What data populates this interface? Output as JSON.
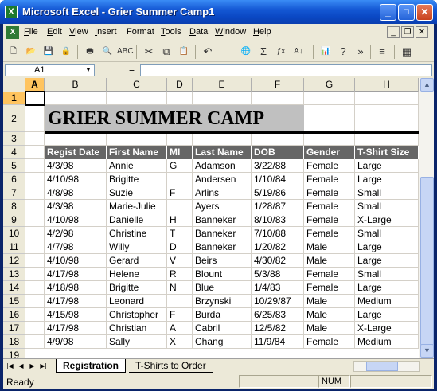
{
  "window": {
    "title": "Microsoft Excel - Grier Summer Camp1",
    "app_icon": "X",
    "minimize": "_",
    "maximize": "□",
    "close": "✕"
  },
  "menu": {
    "items": [
      {
        "key": "F",
        "rest": "ile"
      },
      {
        "key": "E",
        "rest": "dit"
      },
      {
        "key": "V",
        "rest": "iew"
      },
      {
        "key": "I",
        "rest": "nsert"
      },
      {
        "key": "",
        "rest": "Format"
      },
      {
        "key": "T",
        "rest": "ools"
      },
      {
        "key": "D",
        "rest": "ata"
      },
      {
        "key": "W",
        "rest": "indow"
      },
      {
        "key": "H",
        "rest": "elp"
      }
    ],
    "mdi_min": "_",
    "mdi_restore": "❐",
    "mdi_close": "✕"
  },
  "toolbar": {
    "icons": [
      "new-icon",
      "open-icon",
      "save-icon",
      "permission-icon",
      "print-icon",
      "print-preview-icon",
      "spelling-icon",
      "cut-icon",
      "copy-icon",
      "paste-icon",
      "undo-icon",
      "hyperlink-icon",
      "autosum-icon",
      "function-icon",
      "sort-ascending-icon",
      "chart-wizard-icon",
      "help-icon",
      "more-options-icon",
      "align-icon",
      "borders-icon"
    ],
    "glyphs": [
      "🗋",
      "📂",
      "💾",
      "🔒",
      "🖶",
      "🔍",
      "ABC",
      "✂",
      "⧉",
      "📋",
      "↶",
      "🌐",
      "Σ",
      "ƒx",
      "A↓",
      "📊",
      "?",
      "»",
      "≡",
      "▦"
    ]
  },
  "formula_bar": {
    "name_box": "A1",
    "equals": "=",
    "value": ""
  },
  "sheet": {
    "columns": [
      "A",
      "B",
      "C",
      "D",
      "E",
      "F",
      "G",
      "H"
    ],
    "selected_column": "A",
    "rows": [
      "1",
      "2",
      "3",
      "4",
      "5",
      "6",
      "7",
      "8",
      "9",
      "10",
      "11",
      "12",
      "13",
      "14",
      "15",
      "16",
      "17",
      "18",
      "19"
    ],
    "selected_row": "1",
    "banner": "GRIER SUMMER CAMP",
    "headers": [
      "Regist Date",
      "First Name",
      "MI",
      "Last Name",
      "DOB",
      "Gender",
      "T-Shirt Size"
    ],
    "data": [
      [
        "4/3/98",
        "Annie",
        "G",
        "Adamson",
        "3/22/88",
        "Female",
        "Large"
      ],
      [
        "4/10/98",
        "Brigitte",
        "",
        "Andersen",
        "1/10/84",
        "Female",
        "Large"
      ],
      [
        "4/8/98",
        "Suzie",
        "F",
        "Arlins",
        "5/19/86",
        "Female",
        "Small"
      ],
      [
        "4/3/98",
        "Marie-Julie",
        "",
        "Ayers",
        "1/28/87",
        "Female",
        "Small"
      ],
      [
        "4/10/98",
        "Danielle",
        "H",
        "Banneker",
        "8/10/83",
        "Female",
        "X-Large"
      ],
      [
        "4/2/98",
        "Christine",
        "T",
        "Banneker",
        "7/10/88",
        "Female",
        "Small"
      ],
      [
        "4/7/98",
        "Willy",
        "D",
        "Banneker",
        "1/20/82",
        "Male",
        "Large"
      ],
      [
        "4/10/98",
        "Gerard",
        "V",
        "Beirs",
        "4/30/82",
        "Male",
        "Large"
      ],
      [
        "4/17/98",
        "Helene",
        "R",
        "Blount",
        "5/3/88",
        "Female",
        "Small"
      ],
      [
        "4/18/98",
        "Brigitte",
        "N",
        "Blue",
        "1/4/83",
        "Female",
        "Large"
      ],
      [
        "4/17/98",
        "Leonard",
        "",
        "Brzynski",
        "10/29/87",
        "Male",
        "Medium"
      ],
      [
        "4/15/98",
        "Christopher",
        "F",
        "Burda",
        "6/25/83",
        "Male",
        "Large"
      ],
      [
        "4/17/98",
        "Christian",
        "A",
        "Cabril",
        "12/5/82",
        "Male",
        "X-Large"
      ],
      [
        "4/9/98",
        "Sally",
        "X",
        "Chang",
        "11/9/84",
        "Female",
        "Medium"
      ]
    ]
  },
  "tabs": {
    "sheets": [
      "Registration",
      "T-Shirts to Order"
    ],
    "active": "Registration"
  },
  "status": {
    "text": "Ready",
    "num": "NUM"
  }
}
